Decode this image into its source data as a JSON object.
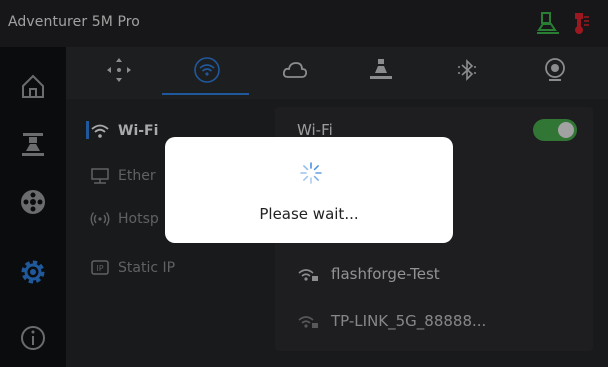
{
  "app": {
    "title": "Adventurer 5M Pro"
  },
  "status_icons": [
    {
      "name": "nozzle-temp-icon",
      "color": "#3bb54a"
    },
    {
      "name": "thermometer-icon",
      "color": "#e0232e"
    }
  ],
  "left_nav": [
    {
      "name": "home-icon",
      "active": false
    },
    {
      "name": "print-icon",
      "active": false
    },
    {
      "name": "filament-icon",
      "active": false
    },
    {
      "name": "settings-gear-icon",
      "active": true,
      "color": "#2f7fe0"
    },
    {
      "name": "info-icon",
      "active": false
    }
  ],
  "top_tabs": [
    {
      "name": "move-axes-icon"
    },
    {
      "name": "wifi-icon",
      "active": true,
      "color": "#2f7fe0"
    },
    {
      "name": "cloud-icon"
    },
    {
      "name": "print-bed-icon"
    },
    {
      "name": "bluetooth-icon"
    },
    {
      "name": "camera-icon"
    }
  ],
  "sub_menu": {
    "wifi": "Wi-Fi",
    "ethernet": "Ether",
    "hotspot": "Hotsp",
    "static_ip": "Static IP"
  },
  "panel": {
    "title": "Wi-Fi",
    "wifi_enabled": true,
    "networks": [
      {
        "ssid": "flashforge-Test"
      },
      {
        "ssid": "TP-LINK_5G_88888..."
      }
    ]
  },
  "dialog": {
    "message": "Please wait..."
  },
  "colors": {
    "accent": "#2f7fe0",
    "toggle_on": "#48a94c",
    "background": "#111214"
  }
}
